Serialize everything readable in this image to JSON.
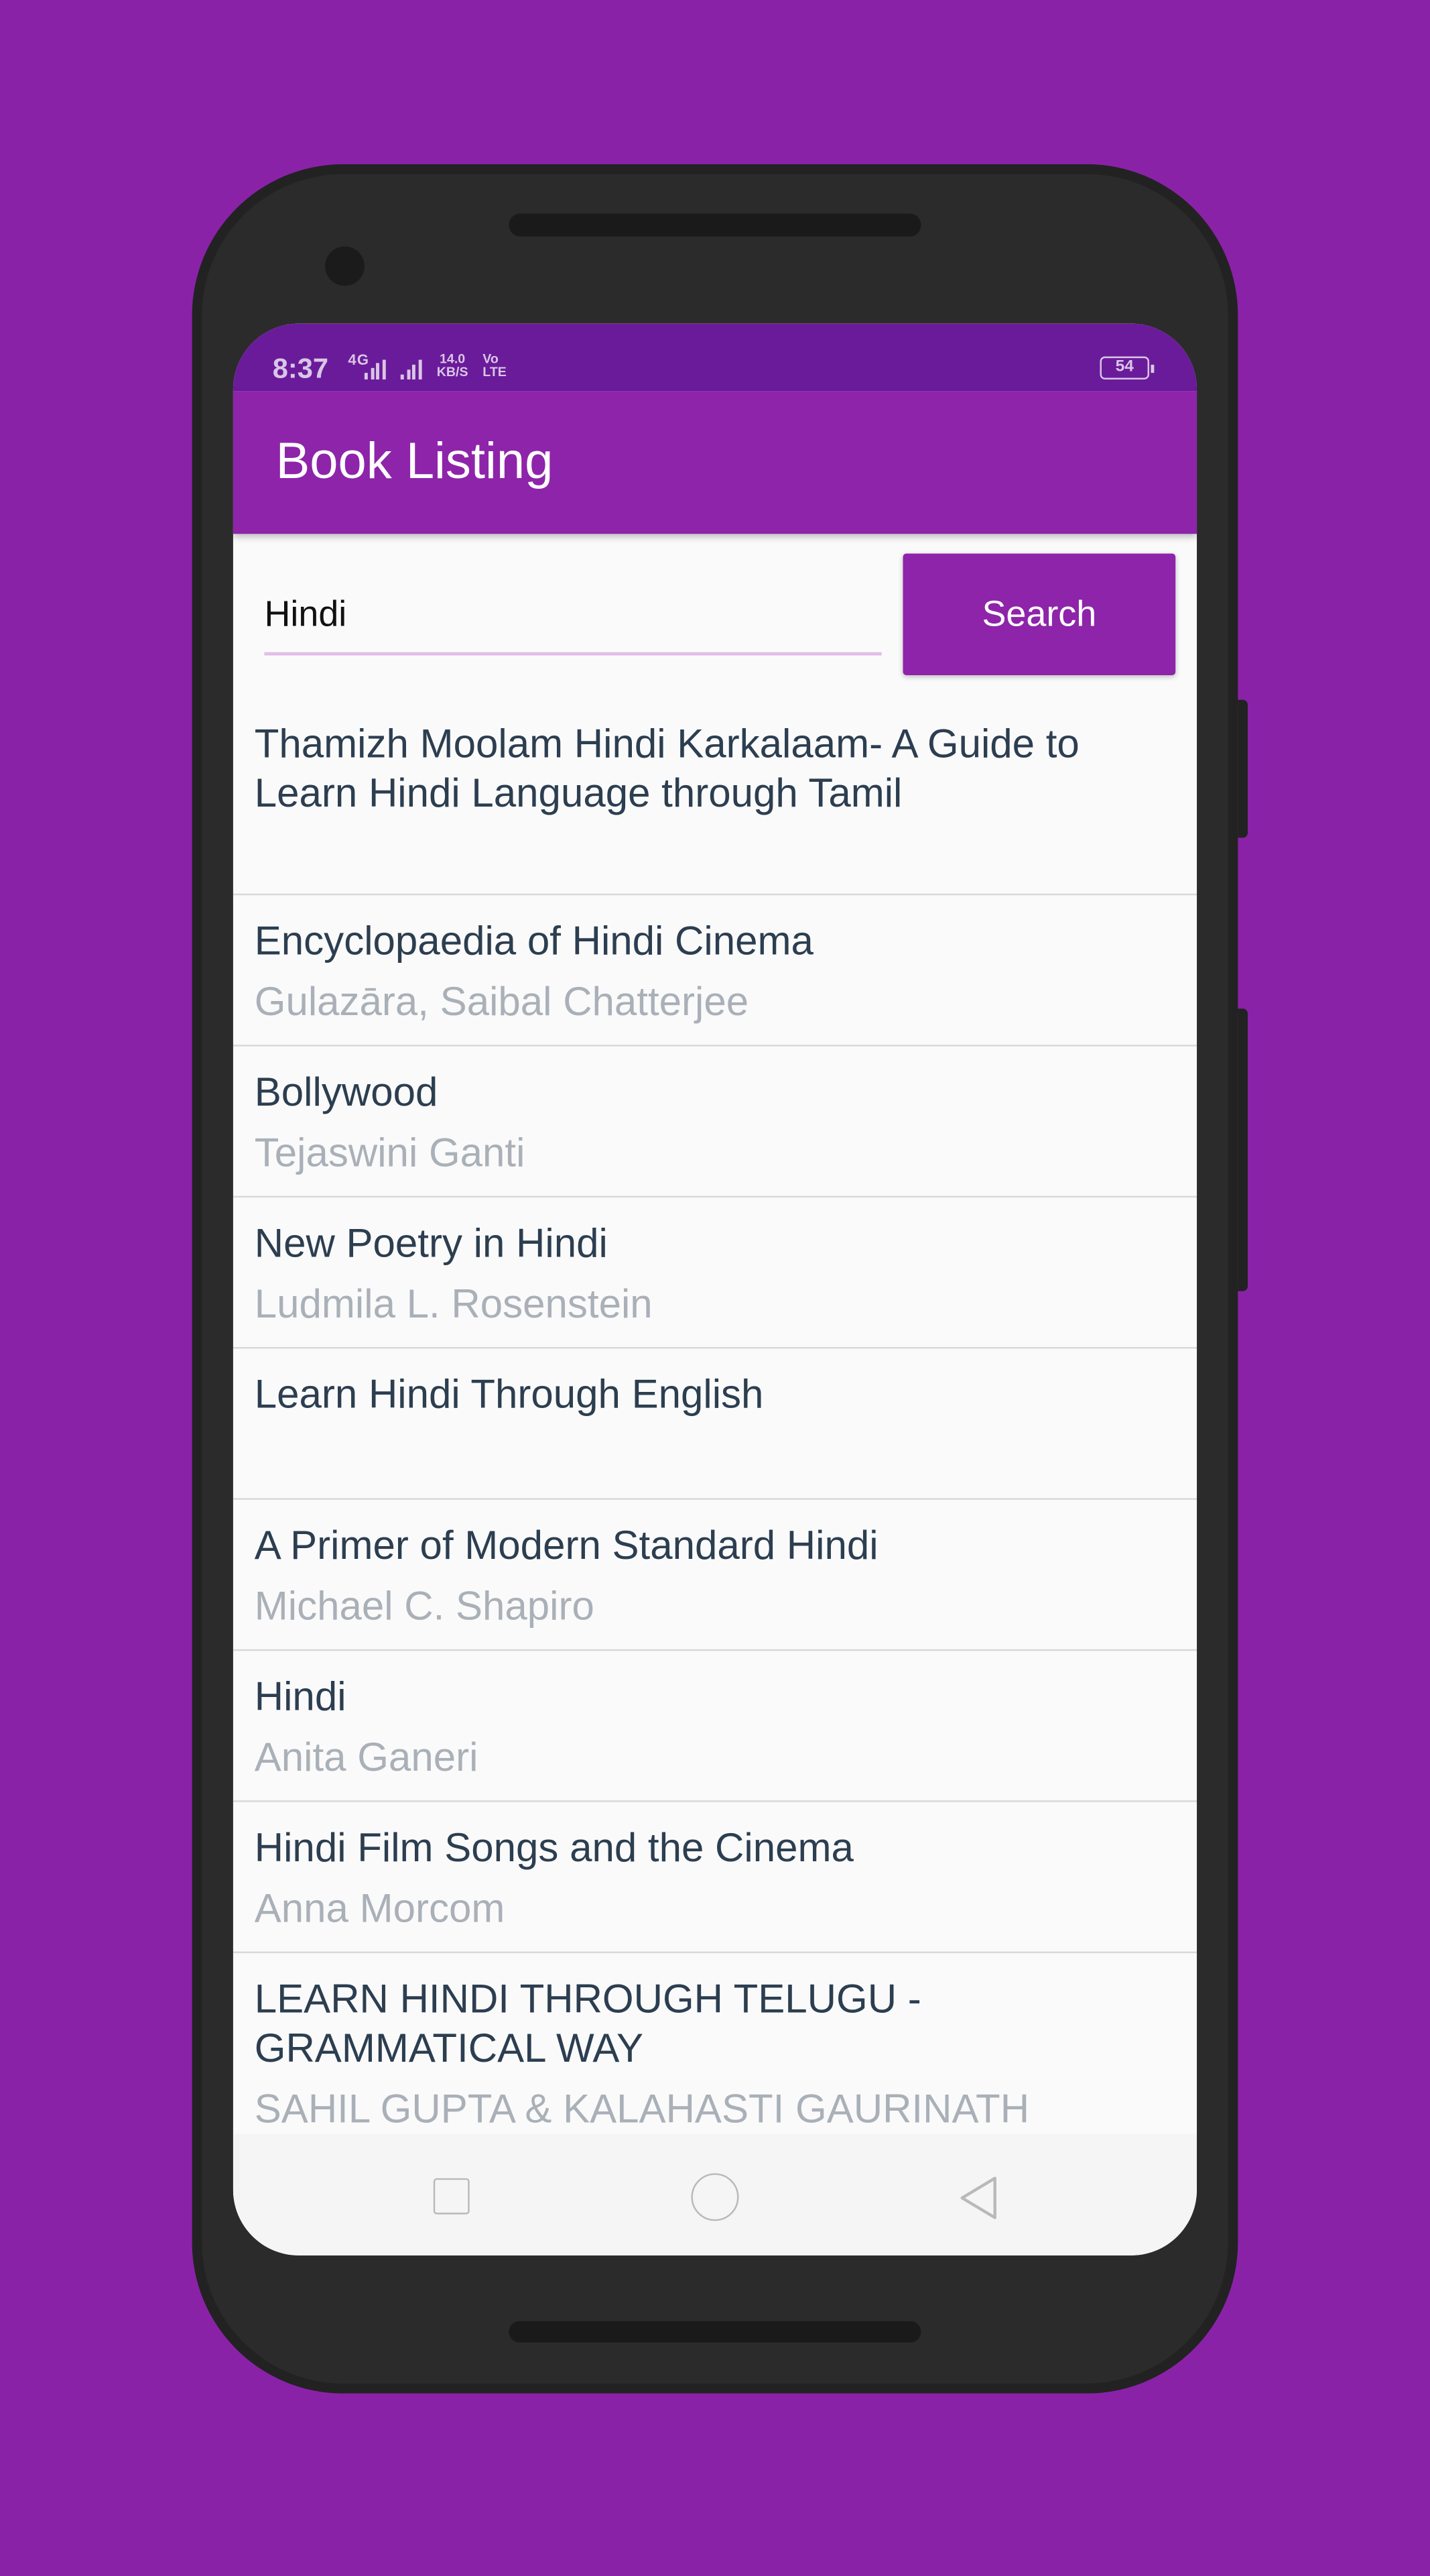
{
  "status_bar": {
    "time": "8:37",
    "network": "4G",
    "speed_value": "14.0",
    "speed_unit": "KB/S",
    "volte_top": "Vo",
    "volte_bottom": "LTE",
    "battery": "54"
  },
  "app_bar": {
    "title": "Book Listing"
  },
  "search": {
    "value": "Hindi",
    "button_label": "Search"
  },
  "books": [
    {
      "title": "Thamizh Moolam Hindi Karkalaam- A Guide to Learn Hindi Language through Tamil",
      "author": ""
    },
    {
      "title": "Encyclopaedia of Hindi Cinema",
      "author": "Gulazāra, Saibal Chatterjee"
    },
    {
      "title": "Bollywood",
      "author": "Tejaswini Ganti"
    },
    {
      "title": "New Poetry in Hindi",
      "author": "Ludmila L. Rosenstein"
    },
    {
      "title": "Learn Hindi Through English",
      "author": ""
    },
    {
      "title": "A Primer of Modern Standard Hindi",
      "author": "Michael C. Shapiro"
    },
    {
      "title": "Hindi",
      "author": "Anita Ganeri"
    },
    {
      "title": "Hindi Film Songs and the Cinema",
      "author": "Anna Morcom"
    },
    {
      "title": "LEARN HINDI THROUGH TELUGU - GRAMMATICAL WAY",
      "author": "SAHIL GUPTA & KALAHASTI GAURINATH"
    }
  ],
  "nav_bar": {
    "icons": [
      "recent-apps-icon",
      "home-icon",
      "back-icon"
    ]
  },
  "colors": {
    "background": "#8a22a8",
    "primary": "#8e24aa",
    "status_bar": "#6a1b9a",
    "title_text": "#2c3e50",
    "author_text": "#aab0b8"
  }
}
